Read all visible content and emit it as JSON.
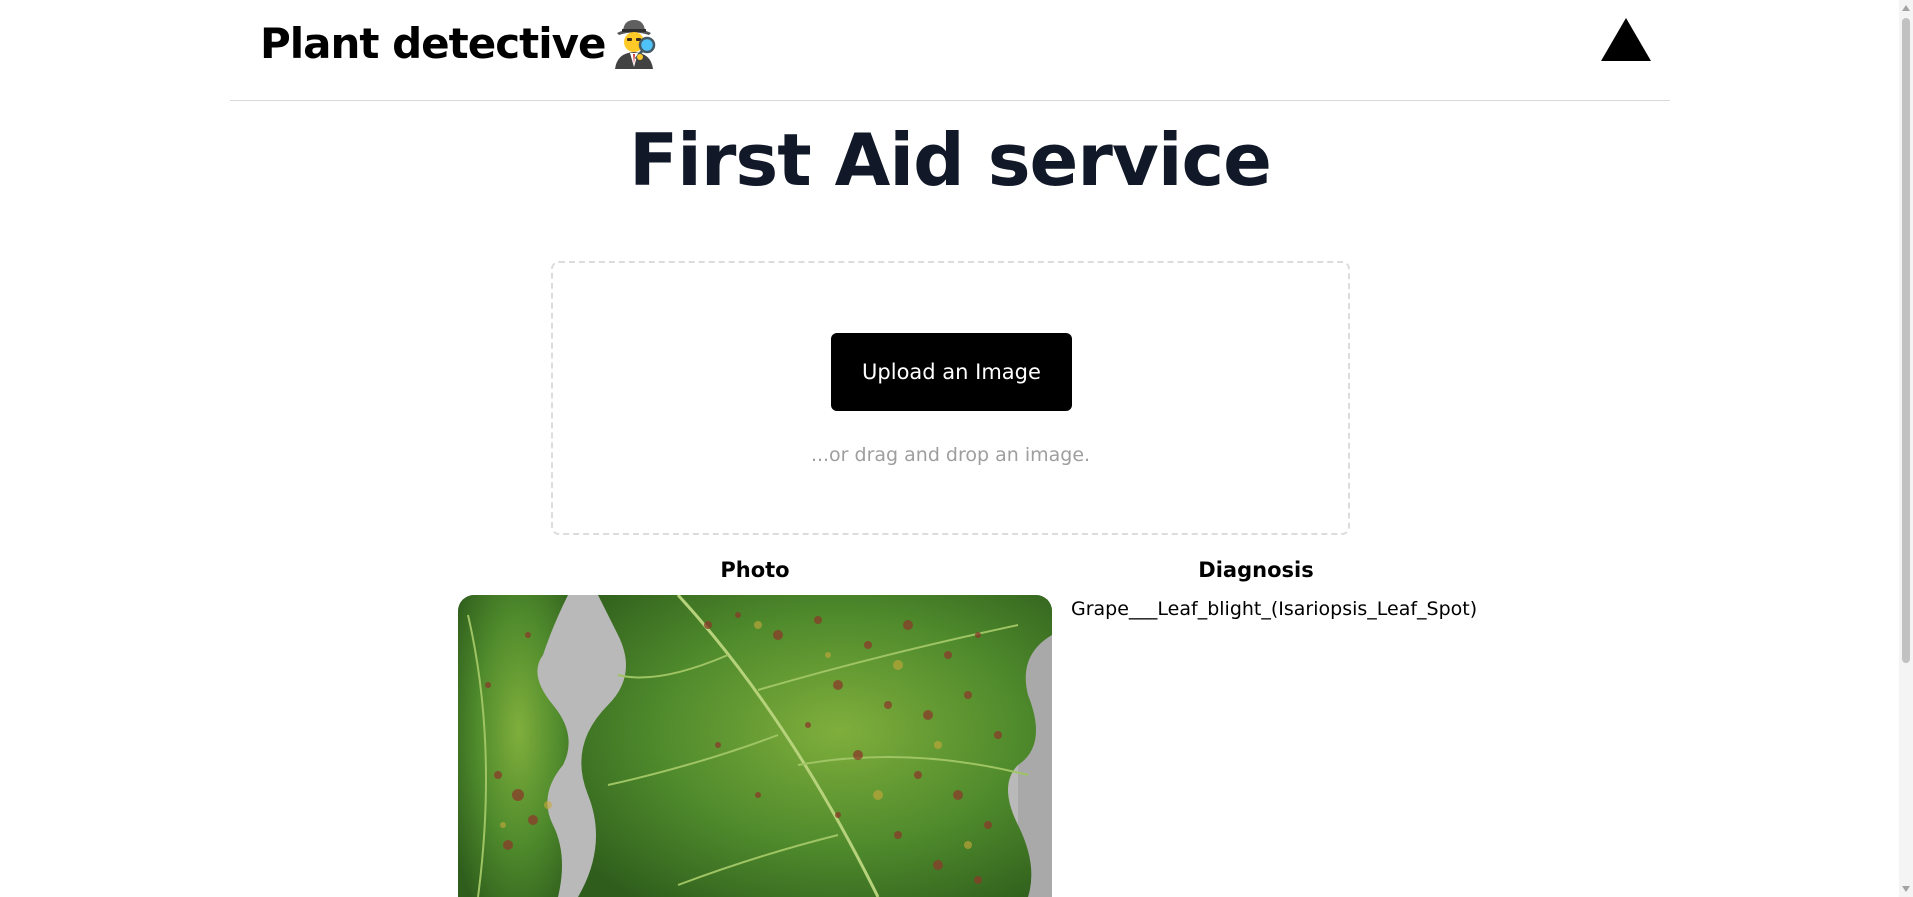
{
  "header": {
    "brand_title": "Plant detective",
    "brand_icon": "detective-icon",
    "logo_icon": "triangle-logo-icon"
  },
  "main": {
    "title": "First Aid service"
  },
  "upload": {
    "button_label": "Upload an Image",
    "hint": "...or drag and drop an image."
  },
  "results": {
    "photo_heading": "Photo",
    "diagnosis_heading": "Diagnosis",
    "diagnosis_value": "Grape___Leaf_blight_(Isariopsis_Leaf_Spot)",
    "photo_subject": "grape-leaf-photo"
  },
  "colors": {
    "title": "#111827",
    "button_bg": "#000000",
    "button_text": "#ffffff",
    "hint": "#9e9e9e",
    "dropzone_border": "#dcdcdc"
  }
}
